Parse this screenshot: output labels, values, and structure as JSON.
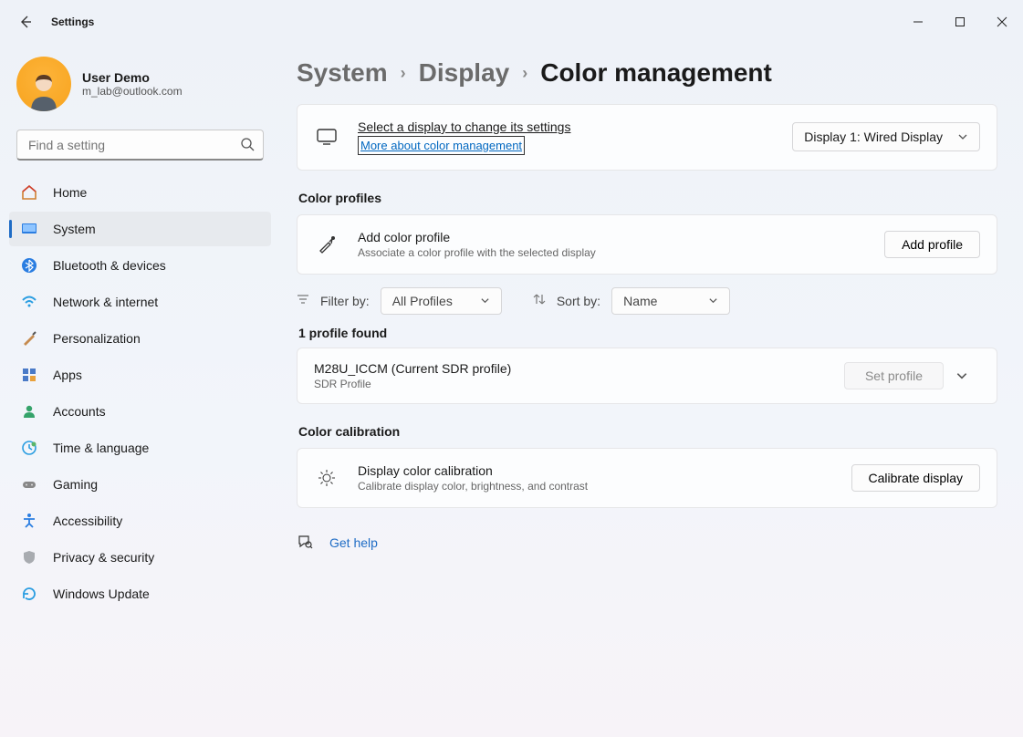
{
  "window": {
    "title": "Settings"
  },
  "user": {
    "name": "User Demo",
    "email": "m_lab@outlook.com"
  },
  "search": {
    "placeholder": "Find a setting"
  },
  "nav": {
    "home": "Home",
    "system": "System",
    "bluetooth": "Bluetooth & devices",
    "network": "Network & internet",
    "personalization": "Personalization",
    "apps": "Apps",
    "accounts": "Accounts",
    "time": "Time & language",
    "gaming": "Gaming",
    "accessibility": "Accessibility",
    "privacy": "Privacy & security",
    "update": "Windows Update"
  },
  "breadcrumb": {
    "l1": "System",
    "l2": "Display",
    "l3": "Color management"
  },
  "display_select": {
    "title": "Select a display to change its settings",
    "link": "More about color management",
    "dropdown": "Display 1: Wired Display"
  },
  "sections": {
    "profiles": "Color profiles",
    "calibration": "Color calibration"
  },
  "add_profile": {
    "title": "Add color profile",
    "sub": "Associate a color profile with the selected display",
    "button": "Add profile"
  },
  "filters": {
    "filter_label": "Filter by:",
    "filter_value": "All Profiles",
    "sort_label": "Sort by:",
    "sort_value": "Name"
  },
  "profile_count": "1 profile found",
  "profile": {
    "name": "M28U_ICCM (Current SDR profile)",
    "type": "SDR Profile",
    "set_button": "Set profile"
  },
  "calibration": {
    "title": "Display color calibration",
    "sub": "Calibrate display color, brightness, and contrast",
    "button": "Calibrate display"
  },
  "help": {
    "label": "Get help"
  }
}
